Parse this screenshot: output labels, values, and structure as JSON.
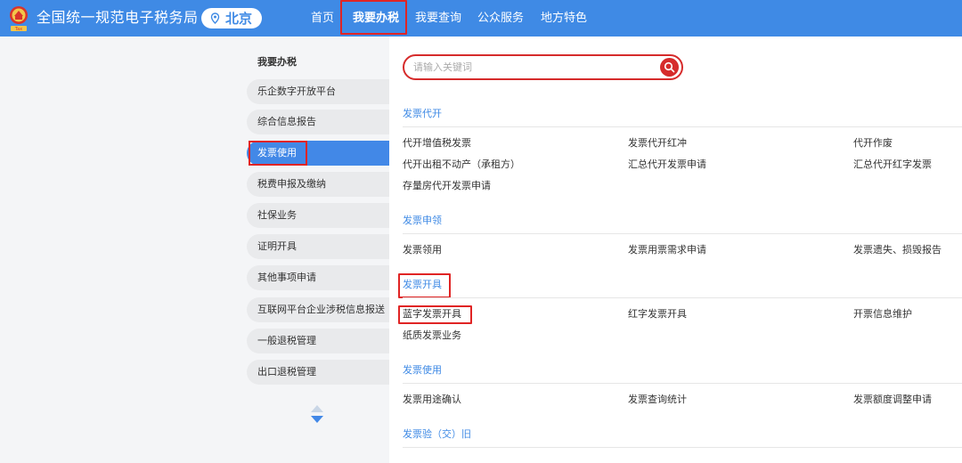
{
  "header": {
    "site_title": "全国统一规范电子税务局",
    "region": "北京",
    "logo_caption": "Tax",
    "nav": [
      "首页",
      "我要办税",
      "我要查询",
      "公众服务",
      "地方特色"
    ],
    "active_nav": "我要办税"
  },
  "sidebar": {
    "title": "我要办税",
    "items": [
      "乐企数字开放平台",
      "综合信息报告",
      "发票使用",
      "税费申报及缴纳",
      "社保业务",
      "证明开具",
      "其他事项申请",
      "互联网平台企业涉税信息报送",
      "一般退税管理",
      "出口退税管理"
    ],
    "active_item": "发票使用"
  },
  "search": {
    "placeholder": "请输入关键词",
    "value": ""
  },
  "sections": [
    {
      "title": "发票代开",
      "links": [
        "代开增值税发票",
        "发票代开红冲",
        "代开作废",
        "代开出租不动产（承租方）",
        "汇总代开发票申请",
        "汇总代开红字发票",
        "存量房代开发票申请"
      ]
    },
    {
      "title": "发票申领",
      "links": [
        "发票领用",
        "发票用票需求申请",
        "发票遗失、损毁报告"
      ]
    },
    {
      "title": "发票开具",
      "links": [
        "蓝字发票开具",
        "红字发票开具",
        "开票信息维护",
        "纸质发票业务"
      ]
    },
    {
      "title": "发票使用",
      "links": [
        "发票用途确认",
        "发票查询统计",
        "发票额度调整申请"
      ]
    },
    {
      "title": "发票验（交）旧",
      "links": []
    }
  ],
  "colors": {
    "header_blue": "#3f8ae5",
    "active_blue": "#4288e7",
    "highlight_red": "#e02424",
    "search_red": "#d62b2b"
  },
  "icons": {
    "logo": "tax-emblem-icon",
    "region": "location-pin-icon",
    "search": "search-icon",
    "scroll": "up-down-arrows-icon"
  }
}
